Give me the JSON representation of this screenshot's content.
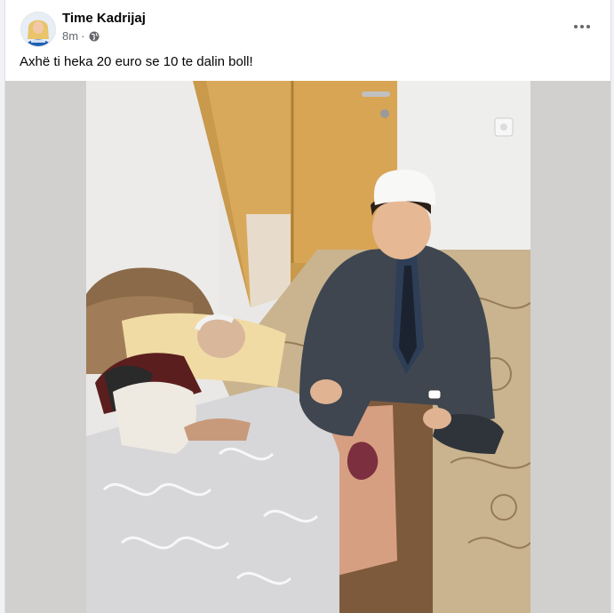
{
  "post": {
    "author": "Time Kadrijaj",
    "time": "8m",
    "separator": "·",
    "privacy_icon": "globe-icon",
    "more_icon": "more-options-icon",
    "text": "Axhë ti heka 20 euro se 10 te dalin boll!",
    "photo": {
      "subject": "photo-elderly-man-in-bed-with-man-in-suit-and-white-hat"
    }
  },
  "colors": {
    "name_text": "#050505",
    "meta_text": "#65676b",
    "photo_backdrop": "#d1d0ce",
    "card_bg": "#ffffff"
  }
}
